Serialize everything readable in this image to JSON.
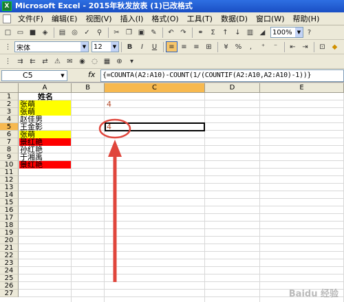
{
  "window": {
    "title": "Microsoft Excel - 2015年秋发放表 (1)已改格式",
    "app_icon_label": "X"
  },
  "menu": [
    "文件(F)",
    "编辑(E)",
    "视图(V)",
    "插入(I)",
    "格式(O)",
    "工具(T)",
    "数据(D)",
    "窗口(W)",
    "帮助(H)"
  ],
  "standard_toolbar": {
    "zoom": "100%"
  },
  "format_toolbar": {
    "font_name": "宋体",
    "font_size": "12",
    "bold": "B",
    "italic": "I",
    "underline": "U",
    "currency": "%",
    "comma": ","
  },
  "formula_bar": {
    "name_box": "C5",
    "fx": "fx",
    "formula": "{=COUNTA(A2:A10)-COUNT(1/(COUNTIF(A2:A10,A2:A10)-1))}"
  },
  "columns": [
    "A",
    "B",
    "C",
    "D",
    "E"
  ],
  "selected_column": "C",
  "rows": [
    "1",
    "2",
    "3",
    "4",
    "5",
    "6",
    "7",
    "8",
    "9",
    "10",
    "11",
    "12",
    "13",
    "14",
    "15",
    "16",
    "17",
    "18",
    "19",
    "20",
    "21",
    "22",
    "23",
    "24",
    "25",
    "26",
    "27"
  ],
  "selected_row": "5",
  "cells": {
    "A1": "姓名",
    "A2": "张萌",
    "A3": "张萌",
    "A4": "赵佳男",
    "A5": "王金影",
    "A6": "张萌",
    "A7": "景红艳",
    "A8": "孙红艳",
    "A9": "于湘禹",
    "A10": "景红艳",
    "C2": "4",
    "C5": "4"
  },
  "colors": {
    "yellow_fill": "#ffff00",
    "red_fill": "#ff0000",
    "annotation": "#e0463c",
    "selection_header": "#f7b94f"
  },
  "watermark": "Baidu 经验"
}
